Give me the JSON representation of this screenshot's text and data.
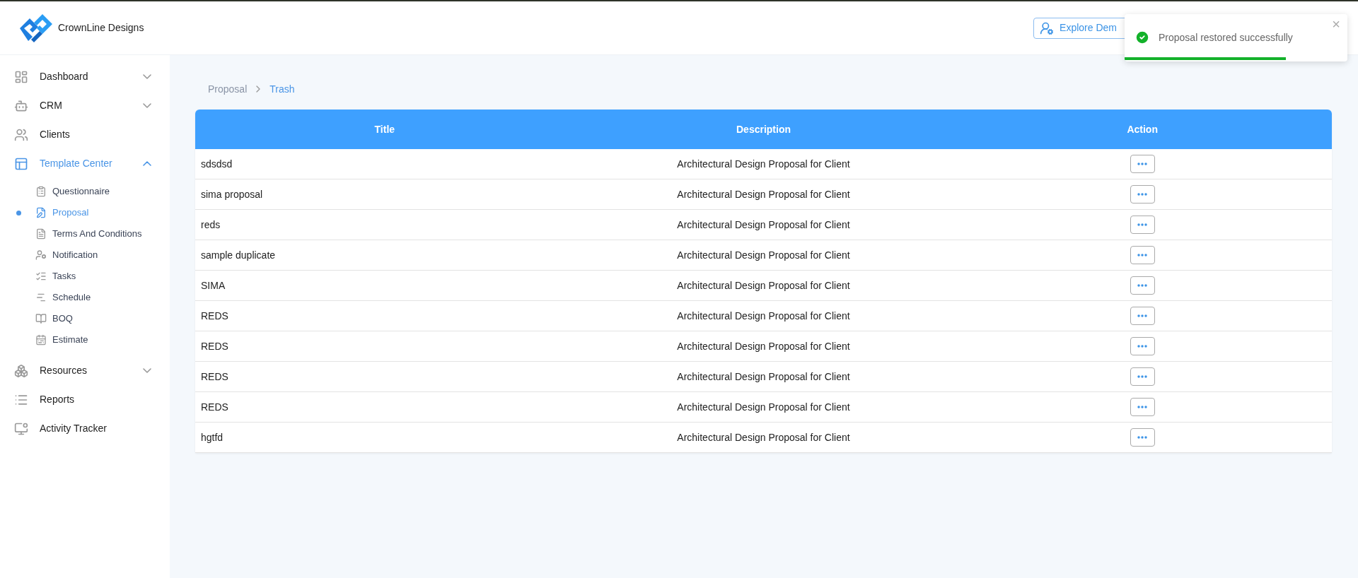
{
  "brand": {
    "name": "CrownLine Designs"
  },
  "header": {
    "demo_button": "Explore Dem"
  },
  "toast": {
    "message": "Proposal restored successfully",
    "close": "×",
    "level": 0.725
  },
  "sidebar": {
    "items": [
      {
        "label": "Dashboard",
        "selected": false,
        "expanded": false
      },
      {
        "label": "CRM",
        "selected": false,
        "expanded": false
      },
      {
        "label": "Clients",
        "selected": false
      },
      {
        "label": "Template Center",
        "selected": true,
        "expanded": true,
        "children": [
          {
            "label": "Questionnaire",
            "selected": false
          },
          {
            "label": "Proposal",
            "selected": true
          },
          {
            "label": "Terms And Conditions",
            "selected": false
          },
          {
            "label": "Notification",
            "selected": false
          },
          {
            "label": "Tasks",
            "selected": false
          },
          {
            "label": "Schedule",
            "selected": false
          },
          {
            "label": "BOQ",
            "selected": false
          },
          {
            "label": "Estimate",
            "selected": false
          }
        ]
      },
      {
        "label": "Resources",
        "selected": false,
        "expanded": false
      },
      {
        "label": "Reports",
        "selected": false
      },
      {
        "label": "Activity Tracker",
        "selected": false
      }
    ]
  },
  "breadcrumb": [
    {
      "label": "Proposal",
      "selected": false
    },
    {
      "label": "Trash",
      "selected": true
    }
  ],
  "table": {
    "columns": [
      "Title",
      "Description",
      "Action"
    ],
    "rows": [
      {
        "title": "sdsdsd",
        "description": "Architectural Design Proposal for Client"
      },
      {
        "title": "sima proposal",
        "description": "Architectural Design Proposal for Client"
      },
      {
        "title": "reds",
        "description": "Architectural Design Proposal for Client"
      },
      {
        "title": "sample duplicate",
        "description": "Architectural Design Proposal for Client"
      },
      {
        "title": "SIMA",
        "description": "Architectural Design Proposal for Client"
      },
      {
        "title": "REDS",
        "description": "Architectural Design Proposal for Client"
      },
      {
        "title": "REDS",
        "description": "Architectural Design Proposal for Client"
      },
      {
        "title": "REDS",
        "description": "Architectural Design Proposal for Client"
      },
      {
        "title": "REDS",
        "description": "Architectural Design Proposal for Client"
      },
      {
        "title": "hgtfd",
        "description": "Architectural Design Proposal for Client"
      }
    ]
  }
}
